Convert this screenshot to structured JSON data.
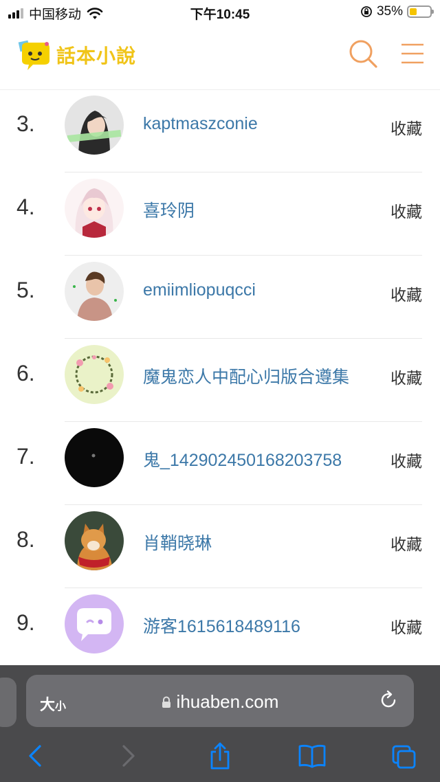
{
  "status_bar": {
    "carrier": "中国移动",
    "time": "下午10:45",
    "battery_percent": "35%",
    "battery_level": 0.35
  },
  "header": {
    "logo_text": "話本小說",
    "search_icon": "search-icon",
    "menu_icon": "hamburger-menu-icon"
  },
  "list": {
    "favorite_label": "收藏",
    "items": [
      {
        "rank": "3.",
        "name": "kaptmaszconie",
        "avatar": "avatar-woman-photo"
      },
      {
        "rank": "4.",
        "name": "喜玲阴",
        "avatar": "avatar-anime-girl"
      },
      {
        "rank": "5.",
        "name": "emiimliopuqcci",
        "avatar": "avatar-man-photo"
      },
      {
        "rank": "6.",
        "name": "魔鬼恋人中配心归版合遵集",
        "avatar": "avatar-floral-wreath"
      },
      {
        "rank": "7.",
        "name": "鬼_142902450168203758",
        "avatar": "avatar-black"
      },
      {
        "rank": "8.",
        "name": "肖鞘晓琳",
        "avatar": "avatar-dog-photo"
      },
      {
        "rank": "9.",
        "name": "游客1615618489116",
        "avatar": "avatar-default-chat"
      }
    ]
  },
  "browser": {
    "text_size_label": "大",
    "text_size_small": "小",
    "url": "ihuaben.com"
  },
  "colors": {
    "link": "#3c78a8",
    "logo_yellow": "#f0c419",
    "header_icon": "#f0a060",
    "ios_blue": "#0a84ff"
  }
}
